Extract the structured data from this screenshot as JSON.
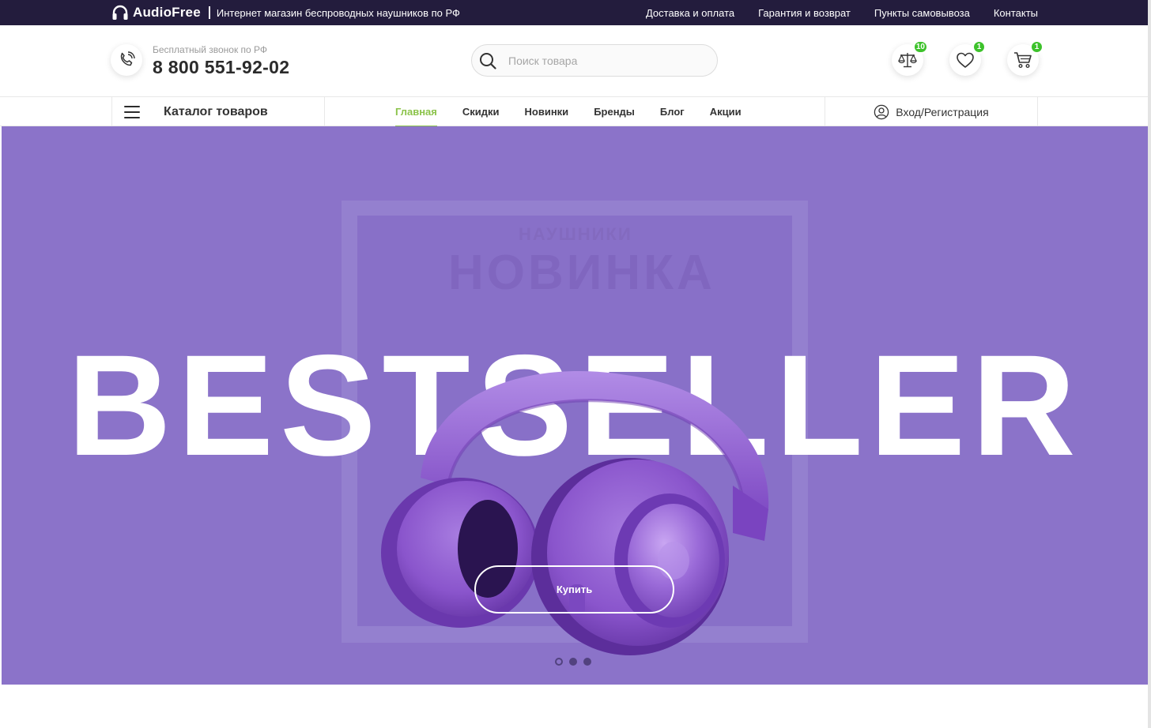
{
  "topbar": {
    "brand_name": "AudioFree",
    "tagline": "Интернет магазин беспроводных наушников по РФ",
    "links": [
      "Доставка и оплата",
      "Гарантия и возврат",
      "Пункты самовывоза",
      "Контакты"
    ]
  },
  "header": {
    "phone_caption": "Бесплатный звонок по РФ",
    "phone_number": "8 800 551-92-02",
    "search_placeholder": "Поиск товара",
    "compare_count": "10",
    "wishlist_count": "1",
    "cart_count": "1"
  },
  "nav": {
    "catalog_label": "Каталог товаров",
    "items": [
      "Главная",
      "Скидки",
      "Новинки",
      "Бренды",
      "Блог",
      "Акции"
    ],
    "active_item": "Главная",
    "login_label": "Вход/Регистрация"
  },
  "hero": {
    "headline": "BESTSELLER",
    "ghost_text": "НОВИНКА",
    "ghost_small": "НАУШНИКИ",
    "buy_label": "Купить",
    "slides": 3,
    "active_slide": 1,
    "background_color": "#8b73c9",
    "accent_color": "#8bc34a"
  }
}
